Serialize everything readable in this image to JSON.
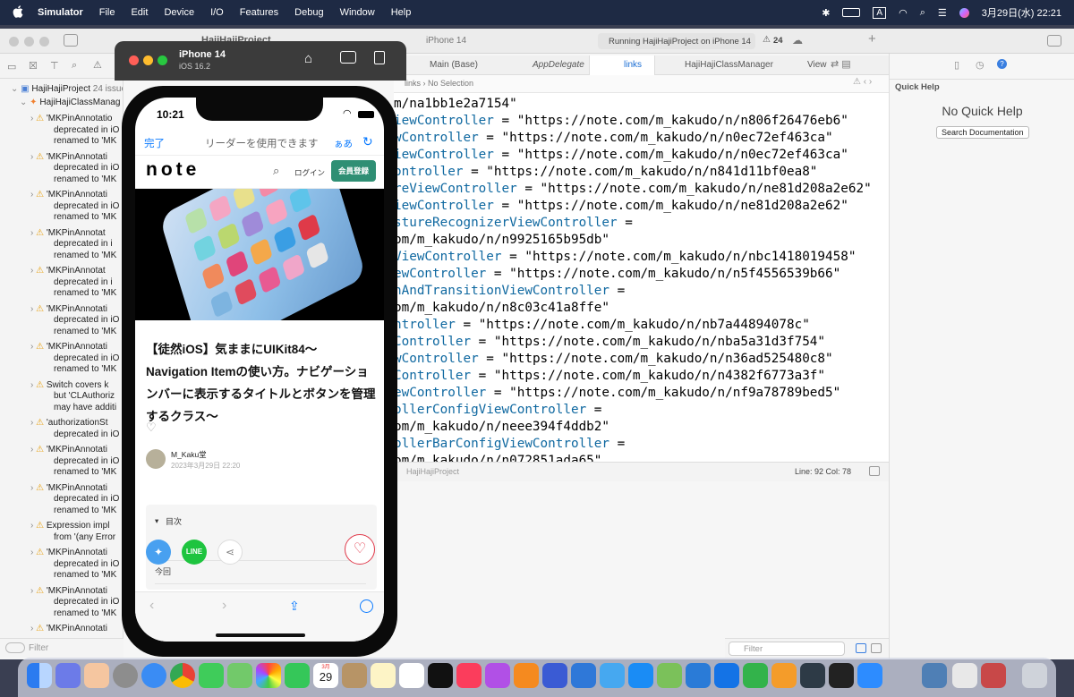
{
  "menubar": {
    "app": "Simulator",
    "items": [
      "File",
      "Edit",
      "Device",
      "I/O",
      "Features",
      "Debug",
      "Window",
      "Help"
    ],
    "input_indicator": "A",
    "clock": "3月29日(水)  22:21"
  },
  "xcode": {
    "project_title": "HajiHajiProject",
    "run_status": "Running HajiHajiProject on iPhone 14",
    "device_name": "iPhone 14",
    "warning_count": "24",
    "tabs": [
      "Main (Base)",
      "AppDelegate",
      "links",
      "HajiHajiClassManager",
      "View"
    ],
    "jump_bar": "links  ›  No Selection",
    "navigator": {
      "root": "HajiHajiProject",
      "root_issues": "24 issues",
      "group": "HajiHajiClassManag",
      "filter_placeholder": "Filter",
      "issues": [
        {
          "lines": [
            "'MKPinAnnotatio",
            "deprecated in iO",
            "renamed to 'MK"
          ]
        },
        {
          "lines": [
            "'MKPinAnnotati",
            "deprecated in iO",
            "renamed to 'MK"
          ]
        },
        {
          "lines": [
            "'MKPinAnnotati",
            "deprecated in iO",
            "renamed to 'MK"
          ]
        },
        {
          "lines": [
            "'MKPinAnnotat",
            "deprecated in i",
            "renamed to 'MK"
          ]
        },
        {
          "lines": [
            "'MKPinAnnotat",
            "deprecated in i",
            "renamed to 'MK"
          ]
        },
        {
          "lines": [
            "'MKPinAnnotati",
            "deprecated in iO",
            "renamed to 'MK"
          ]
        },
        {
          "lines": [
            "'MKPinAnnotati",
            "deprecated in iO",
            "renamed to 'MK"
          ]
        },
        {
          "lines": [
            "Switch covers k",
            "but 'CLAuthoriz",
            "may have additi"
          ]
        },
        {
          "lines": [
            "'authorizationSt",
            "deprecated in iO"
          ]
        },
        {
          "lines": [
            "'MKPinAnnotati",
            "deprecated in iO",
            "renamed to 'MK"
          ]
        },
        {
          "lines": [
            "'MKPinAnnotati",
            "deprecated in iO",
            "renamed to 'MK"
          ]
        },
        {
          "lines": [
            "Expression impl",
            "from '(any Error"
          ]
        },
        {
          "lines": [
            "'MKPinAnnotati",
            "deprecated in iO",
            "renamed to 'MK"
          ]
        },
        {
          "lines": [
            "'MKPinAnnotati",
            "deprecated in iO",
            "renamed to 'MK"
          ]
        },
        {
          "lines": [
            "'MKPinAnnotati"
          ]
        }
      ]
    },
    "code_lines": [
      {
        "id": "",
        "rest": "m/na1bb1e2a7154\""
      },
      {
        "id": "iewController",
        "rest": " = \"https://note.com/m_kakudo/n/n806f26476eb6\""
      },
      {
        "id": "wController",
        "rest": " = \"https://note.com/m_kakudo/n/n0ec72ef463ca\""
      },
      {
        "id": "iewController",
        "rest": " = \"https://note.com/m_kakudo/n/n0ec72ef463ca\""
      },
      {
        "id": "ontroller",
        "rest": " = \"https://note.com/m_kakudo/n/n841d11bf0ea8\""
      },
      {
        "id": "reViewController",
        "rest": " = \"https://note.com/m_kakudo/n/ne81d208a2e62\""
      },
      {
        "id": "iewController",
        "rest": " = \"https://note.com/m_kakudo/n/ne81d208a2e62\""
      },
      {
        "id": "stureRecognizerViewController",
        "rest": " ="
      },
      {
        "id": "",
        "rest": "om/m_kakudo/n/n9925165b95db\""
      },
      {
        "id": "ViewController",
        "rest": " = \"https://note.com/m_kakudo/n/nbc1418019458\""
      },
      {
        "id": "ewController",
        "rest": " = \"https://note.com/m_kakudo/n/n5f4556539b66\""
      },
      {
        "id": "nAndTransitionViewController",
        "rest": " ="
      },
      {
        "id": "",
        "rest": "om/m_kakudo/n/n8c03c41a8ffe\""
      },
      {
        "id": "ntroller",
        "rest": " = \"https://note.com/m_kakudo/n/nb7a44894078c\""
      },
      {
        "id": "Controller",
        "rest": " = \"https://note.com/m_kakudo/n/nba5a31d3f754\""
      },
      {
        "id": "wController",
        "rest": " = \"https://note.com/m_kakudo/n/n36ad525480c8\""
      },
      {
        "id": "Controller",
        "rest": " = \"https://note.com/m_kakudo/n/n4382f6773a3f\""
      },
      {
        "id": "ewController",
        "rest": " = \"https://note.com/m_kakudo/n/nf9a78789bed5\""
      },
      {
        "id": "ollerConfigViewController",
        "rest": " ="
      },
      {
        "id": "",
        "rest": "om/m_kakudo/n/neee394f4ddb2\""
      },
      {
        "id": "ollerBarConfigViewController",
        "rest": " ="
      },
      {
        "id": "",
        "rest": "om/m_kakudo/n/n072851ada65\""
      }
    ],
    "status": {
      "project": "HajiHajiProject",
      "line_col": "Line: 92  Col: 78"
    },
    "editor_filter_placeholder": "Filter",
    "inspector": {
      "title": "Quick Help",
      "empty": "No Quick Help",
      "button": "Search Documentation"
    }
  },
  "simulator": {
    "device": "iPhone 14",
    "os": "iOS 16.2"
  },
  "phone": {
    "time": "10:21",
    "browser": {
      "done": "完了",
      "reader": "リーダーを使用できます",
      "text_size": "ぁあ"
    },
    "note": {
      "logo": "note",
      "login": "ログイン",
      "signup": "会員登録",
      "title": "【徒然iOS】気ままにUIKit84〜Navigation Itemの使い方。ナビゲーションバーに表示するタイトルとボタンを管理するクラス〜",
      "author": "M_Kaku堂",
      "date": "2023年3月29日 22:20",
      "toc": "目次",
      "toc_first": "今回"
    }
  },
  "dock": {
    "calendar_day": "29",
    "calendar_month": "3月"
  },
  "colors": {
    "swift_ident": "#0f68a0",
    "note_green": "#2f8f74",
    "safari_blue": "#0a7aff",
    "like_red": "#e0394a"
  }
}
